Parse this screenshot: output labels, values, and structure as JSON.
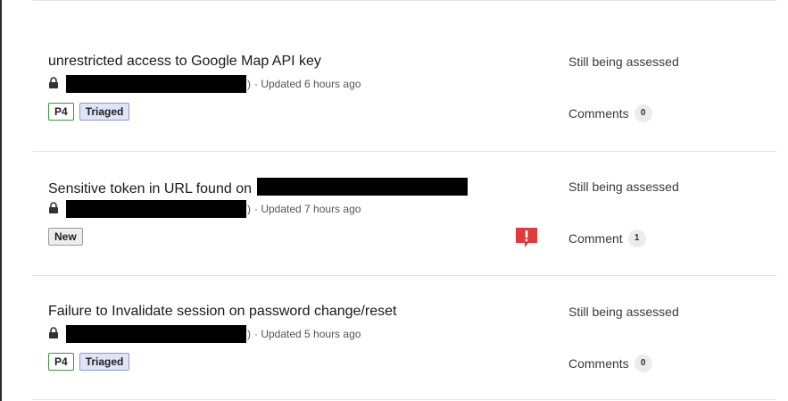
{
  "colors": {
    "priority_border": "#3a9a3a",
    "triaged_bg": "#dfe5f7",
    "triaged_border": "#8a9ad0",
    "alert_red": "#e03a3a",
    "divider": "#e2e2e2"
  },
  "reports": [
    {
      "title": "unrestricted access to Google Map API key",
      "updated": "· Updated 6 hours ago",
      "priority": "P4",
      "state": "Triaged",
      "status": "Still being assessed",
      "comments_label": "Comments",
      "comments_count": "0"
    },
    {
      "title": "Sensitive token in URL found on",
      "updated": "· Updated 7 hours ago",
      "state": "New",
      "status": "Still being assessed",
      "comments_label": "Comment",
      "comments_count": "1",
      "icon": "alert-flag-icon"
    },
    {
      "title": "Failure to Invalidate session on password change/reset",
      "updated": "· Updated 5 hours ago",
      "priority": "P4",
      "state": "Triaged",
      "status": "Still being assessed",
      "comments_label": "Comments",
      "comments_count": "0"
    }
  ]
}
